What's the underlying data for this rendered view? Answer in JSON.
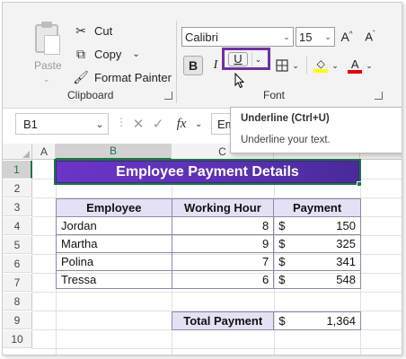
{
  "ribbon": {
    "clipboard": {
      "paste_label": "Paste",
      "cut_label": "Cut",
      "copy_label": "Copy",
      "format_painter_label": "Format Painter",
      "group_label": "Clipboard"
    },
    "font": {
      "font_name": "Calibri",
      "font_size": "15",
      "bold_label": "B",
      "italic_label": "I",
      "underline_label": "U",
      "group_label": "Font",
      "highlight_color": "#ffff00",
      "font_color": "#e00000"
    }
  },
  "formula_bar": {
    "cell_ref": "B1",
    "fx_label": "fx",
    "content": "Em"
  },
  "tooltip": {
    "title": "Underline (Ctrl+U)",
    "description": "Underline your text."
  },
  "grid": {
    "columns": [
      "A",
      "B",
      "C"
    ],
    "rows": [
      "1",
      "2",
      "3",
      "4",
      "5",
      "6",
      "7",
      "8",
      "9",
      "10"
    ],
    "title": "Employee Payment Details",
    "headers": [
      "Employee",
      "Working Hour",
      "Payment"
    ],
    "data": [
      {
        "employee": "Jordan",
        "hours": "8",
        "currency": "$",
        "payment": "150"
      },
      {
        "employee": "Martha",
        "hours": "9",
        "currency": "$",
        "payment": "325"
      },
      {
        "employee": "Polina",
        "hours": "7",
        "currency": "$",
        "payment": "341"
      },
      {
        "employee": "Tressa",
        "hours": "6",
        "currency": "$",
        "payment": "548"
      }
    ],
    "total_label": "Total Payment",
    "total_currency": "$",
    "total_value": "1,364"
  },
  "colors": {
    "title_fill": "#5a30b0",
    "header_fill": "#e4e1f5",
    "highlight_box": "#7030a0",
    "selection": "#217346"
  }
}
